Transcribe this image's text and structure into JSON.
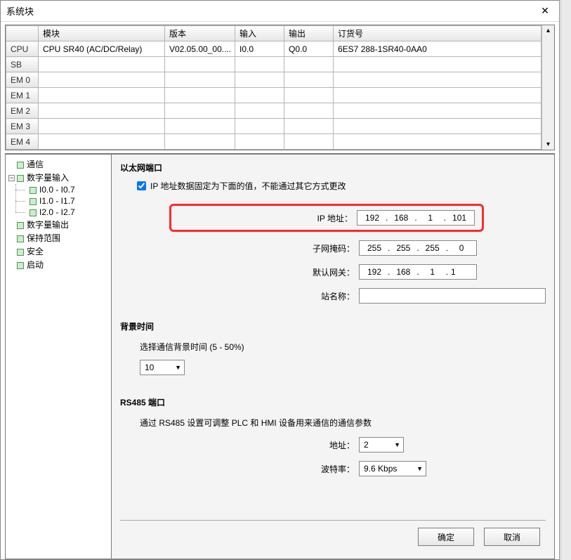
{
  "window": {
    "title": "系统块"
  },
  "grid": {
    "headers": [
      "",
      "模块",
      "版本",
      "输入",
      "输出",
      "订货号"
    ],
    "rowHeaders": [
      "CPU",
      "SB",
      "EM 0",
      "EM 1",
      "EM 2",
      "EM 3",
      "EM 4"
    ],
    "rows": [
      [
        "CPU SR40 (AC/DC/Relay)",
        "V02.05.00_00....",
        "I0.0",
        "Q0.0",
        "6ES7 288-1SR40-0AA0"
      ],
      [
        "",
        "",
        "",
        "",
        ""
      ],
      [
        "",
        "",
        "",
        "",
        ""
      ],
      [
        "",
        "",
        "",
        "",
        ""
      ],
      [
        "",
        "",
        "",
        "",
        ""
      ],
      [
        "",
        "",
        "",
        "",
        ""
      ],
      [
        "",
        "",
        "",
        "",
        ""
      ]
    ]
  },
  "tree": {
    "items": [
      {
        "label": "通信"
      },
      {
        "label": "数字量输入",
        "expanded": true,
        "children": [
          "I0.0 - I0.7",
          "I1.0 - I1.7",
          "I2.0 - I2.7"
        ]
      },
      {
        "label": "数字量输出"
      },
      {
        "label": "保持范围"
      },
      {
        "label": "安全"
      },
      {
        "label": "启动"
      }
    ]
  },
  "ethernet": {
    "title": "以太网端口",
    "fixed_label": "IP 地址数据固定为下面的值，不能通过其它方式更改",
    "ip_label": "IP 地址：",
    "ip": [
      "192",
      "168",
      "1",
      "101"
    ],
    "mask_label": "子网掩码：",
    "mask": [
      "255",
      "255",
      "255",
      "0"
    ],
    "gw_label": "默认网关：",
    "gw": [
      "192",
      "168",
      "1",
      "1"
    ],
    "station_label": "站名称："
  },
  "background": {
    "title": "背景时间",
    "desc": "选择通信背景时间 (5 - 50%)",
    "value": "10"
  },
  "rs485": {
    "title": "RS485  端口",
    "desc": "通过 RS485 设置可调整 PLC 和 HMI 设备用来通信的通信参数",
    "addr_label": "地址：",
    "addr_value": "2",
    "baud_label": "波特率：",
    "baud_value": "9.6 Kbps"
  },
  "buttons": {
    "ok": "确定",
    "cancel": "取消"
  }
}
